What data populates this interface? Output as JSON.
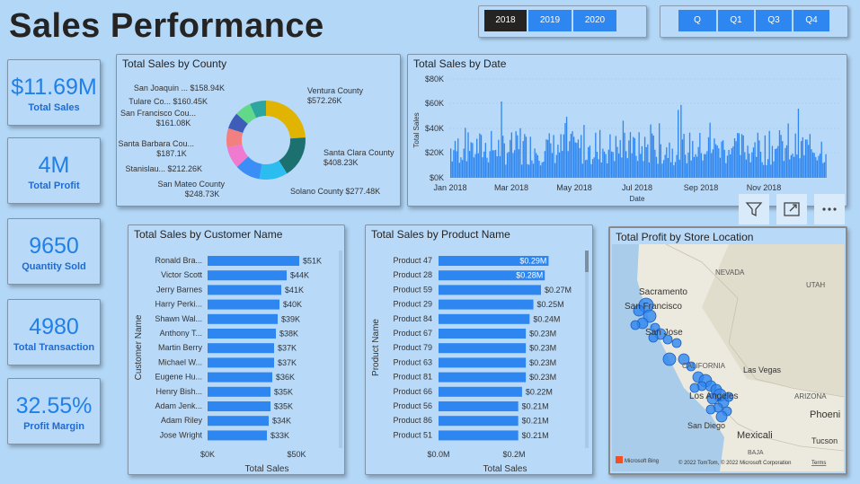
{
  "title": "Sales Performance",
  "year_slicer": {
    "options": [
      "2018",
      "2019",
      "2020"
    ],
    "selected": "2018"
  },
  "quarter_slicer": {
    "options": [
      "Q",
      "Q1",
      "Q3",
      "Q4"
    ]
  },
  "kpis": [
    {
      "value": "$11.69M",
      "label": "Total Sales"
    },
    {
      "value": "4M",
      "label": "Total Profit"
    },
    {
      "value": "9650",
      "label": "Quantity Sold"
    },
    {
      "value": "4980",
      "label": "Total Transaction"
    },
    {
      "value": "32.55%",
      "label": "Profit Margin"
    }
  ],
  "county_chart": {
    "title": "Total Sales by County",
    "labels": [
      {
        "name": "Ventura County",
        "value": "$572.26K"
      },
      {
        "name": "Santa Clara County",
        "value": "$408.23K"
      },
      {
        "name": "Solano County",
        "value": "$277.48K"
      },
      {
        "name": "San Mateo County",
        "value": "$248.73K"
      },
      {
        "name": "Stanislau...",
        "value": "$212.26K"
      },
      {
        "name": "Santa Barbara Cou...",
        "value": "$187.1K"
      },
      {
        "name": "San Francisco Cou...",
        "value": "$161.08K"
      },
      {
        "name": "Tulare Co...",
        "value": "$160.45K"
      },
      {
        "name": "San Joaquin ...",
        "value": "$158.94K"
      }
    ]
  },
  "date_chart": {
    "title": "Total Sales by Date",
    "ylabel": "Total Sales",
    "xlabel": "Date",
    "yticks": [
      "$80K",
      "$60K",
      "$40K",
      "$20K",
      "$0K"
    ],
    "xticks": [
      "Jan 2018",
      "Mar 2018",
      "May 2018",
      "Jul 2018",
      "Sep 2018",
      "Nov 2018"
    ]
  },
  "customer_chart": {
    "title": "Total Sales by Customer Name",
    "ylabel": "Customer Name",
    "xlabel": "Total Sales",
    "xticks": [
      "$0K",
      "$50K"
    ]
  },
  "product_chart": {
    "title": "Total Sales by Product Name",
    "ylabel": "Product Name",
    "xlabel": "Total Sales",
    "xticks": [
      "$0.0M",
      "$0.2M"
    ]
  },
  "map": {
    "title": "Total Profit by Store Location",
    "places": [
      "Sacramento",
      "NEVADA",
      "UTAH",
      "San Francisco",
      "San Jose",
      "CALIFORNIA",
      "Las Vegas",
      "Los Angeles",
      "ARIZONA",
      "San Diego",
      "Phoeni",
      "Mexicali",
      "Tucson",
      "BAJA"
    ],
    "logo": "Microsoft Bing",
    "copyright": "© 2022 TomTom, © 2022 Microsoft Corporation",
    "terms": "Terms"
  },
  "chart_data": [
    {
      "type": "pie",
      "title": "Total Sales by County",
      "categories": [
        "Ventura County",
        "Santa Clara County",
        "Solano County",
        "San Mateo County",
        "Stanislau...",
        "Santa Barbara Cou...",
        "San Francisco Cou...",
        "Tulare Co...",
        "San Joaquin ..."
      ],
      "values": [
        572.26,
        408.23,
        277.48,
        248.73,
        212.26,
        187.1,
        161.08,
        160.45,
        158.94
      ],
      "colors": [
        "#e0b400",
        "#1c7070",
        "#2bbcf0",
        "#3a8ef5",
        "#f07ad0",
        "#f28080",
        "#3d5db8",
        "#62d98a",
        "#2ea6a0"
      ]
    },
    {
      "type": "bar",
      "title": "Total Sales by Date",
      "xlabel": "Date",
      "ylabel": "Total Sales",
      "ylim": [
        0,
        80
      ],
      "x_range": [
        "Jan 2018",
        "Dec 2018"
      ],
      "color": "#2e86f0"
    },
    {
      "type": "bar",
      "title": "Total Sales by Customer Name",
      "xlabel": "Total Sales",
      "ylabel": "Customer Name",
      "xlim": [
        0,
        60
      ],
      "categories": [
        "Ronald Bra...",
        "Victor Scott",
        "Jerry Barnes",
        "Harry Perki...",
        "Shawn Wal...",
        "Anthony T...",
        "Martin Berry",
        "Michael W...",
        "Eugene Hu...",
        "Henry Bish...",
        "Adam Jenk...",
        "Adam Riley",
        "Jose Wright"
      ],
      "values": [
        51,
        44,
        41,
        40,
        39,
        38,
        37,
        37,
        36,
        35,
        35,
        34,
        33
      ],
      "labels": [
        "$51K",
        "$44K",
        "$41K",
        "$40K",
        "$39K",
        "$38K",
        "$37K",
        "$37K",
        "$36K",
        "$35K",
        "$35K",
        "$34K",
        "$33K"
      ],
      "color": "#2e86f0"
    },
    {
      "type": "bar",
      "title": "Total Sales by Product Name",
      "xlabel": "Total Sales",
      "ylabel": "Product Name",
      "xlim": [
        0,
        0.36
      ],
      "categories": [
        "Product 47",
        "Product 28",
        "Product 59",
        "Product 29",
        "Product 84",
        "Product 67",
        "Product 79",
        "Product 63",
        "Product 81",
        "Product 66",
        "Product 56",
        "Product 86",
        "Product 51"
      ],
      "values": [
        0.29,
        0.28,
        0.27,
        0.25,
        0.24,
        0.23,
        0.23,
        0.23,
        0.23,
        0.22,
        0.21,
        0.21,
        0.21
      ],
      "labels": [
        "$0.29M",
        "$0.28M",
        "$0.27M",
        "$0.25M",
        "$0.24M",
        "$0.23M",
        "$0.23M",
        "$0.23M",
        "$0.23M",
        "$0.22M",
        "$0.21M",
        "$0.21M",
        "$0.21M"
      ],
      "color": "#2e86f0"
    }
  ]
}
